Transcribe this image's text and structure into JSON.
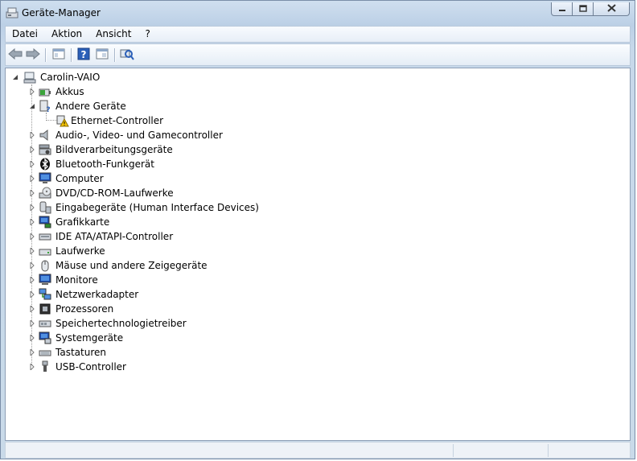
{
  "window": {
    "title": "Geräte-Manager",
    "icon": "device-manager-icon"
  },
  "menu": [
    {
      "label": "Datei"
    },
    {
      "label": "Aktion"
    },
    {
      "label": "Ansicht"
    },
    {
      "label": "?"
    }
  ],
  "toolbar": {
    "buttons": [
      "back-arrow-icon",
      "forward-arrow-icon",
      "properties-icon",
      "help-icon",
      "console-tree-icon",
      "scan-hardware-icon"
    ]
  },
  "tree": {
    "root": {
      "label": "Carolin-VAIO",
      "icon": "computer-icon",
      "expanded": true
    },
    "categories": [
      {
        "label": "Akkus",
        "icon": "battery-icon",
        "expanded": false
      },
      {
        "label": "Andere Geräte",
        "icon": "unknown-device-icon",
        "expanded": true,
        "children": [
          {
            "label": "Ethernet-Controller",
            "icon": "warning-device-icon"
          }
        ]
      },
      {
        "label": "Audio-, Video- und Gamecontroller",
        "icon": "speaker-icon",
        "expanded": false
      },
      {
        "label": "Bildverarbeitungsgeräte",
        "icon": "camera-icon",
        "expanded": false
      },
      {
        "label": "Bluetooth-Funkgerät",
        "icon": "bluetooth-icon",
        "expanded": false
      },
      {
        "label": "Computer",
        "icon": "monitor-computer-icon",
        "expanded": false
      },
      {
        "label": "DVD/CD-ROM-Laufwerke",
        "icon": "dvd-drive-icon",
        "expanded": false
      },
      {
        "label": "Eingabegeräte (Human Interface Devices)",
        "icon": "hid-icon",
        "expanded": false
      },
      {
        "label": "Grafikkarte",
        "icon": "display-adapter-icon",
        "expanded": false
      },
      {
        "label": "IDE ATA/ATAPI-Controller",
        "icon": "ide-controller-icon",
        "expanded": false
      },
      {
        "label": "Laufwerke",
        "icon": "disk-drive-icon",
        "expanded": false
      },
      {
        "label": "Mäuse und andere Zeigegeräte",
        "icon": "mouse-icon",
        "expanded": false
      },
      {
        "label": "Monitore",
        "icon": "monitor-icon",
        "expanded": false
      },
      {
        "label": "Netzwerkadapter",
        "icon": "network-adapter-icon",
        "expanded": false
      },
      {
        "label": "Prozessoren",
        "icon": "processor-icon",
        "expanded": false
      },
      {
        "label": "Speichertechnologietreiber",
        "icon": "storage-technology-icon",
        "expanded": false
      },
      {
        "label": "Systemgeräte",
        "icon": "system-devices-icon",
        "expanded": false
      },
      {
        "label": "Tastaturen",
        "icon": "keyboard-icon",
        "expanded": false
      },
      {
        "label": "USB-Controller",
        "icon": "usb-icon",
        "expanded": false
      }
    ]
  },
  "colors": {
    "title_bg": "#bcd0e6",
    "close_button": "#d0dded",
    "warning": "#f5c400",
    "monitor_blue": "#1f4fb0"
  }
}
